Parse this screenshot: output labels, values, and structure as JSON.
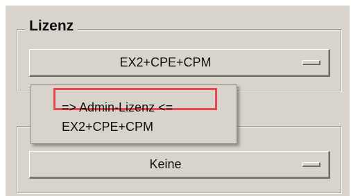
{
  "license_group": {
    "title": "Lizenz",
    "selected_value": "EX2+CPE+CPM"
  },
  "second_group": {
    "selected_value": "Keine"
  },
  "dropdown_menu": {
    "items": [
      {
        "label": "=> Admin-Lizenz <=",
        "highlighted": true
      },
      {
        "label": "EX2+CPE+CPM",
        "highlighted": false
      }
    ],
    "highlight_color": "#e8474b"
  }
}
